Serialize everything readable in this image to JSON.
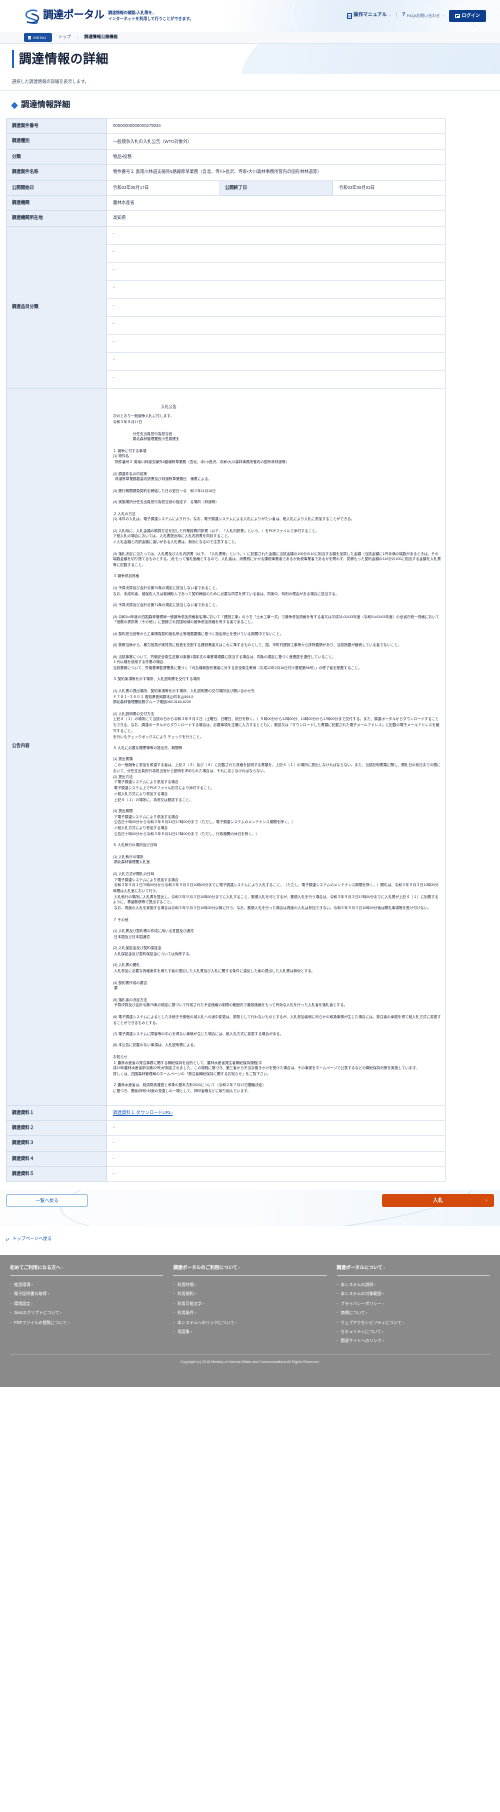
{
  "header": {
    "logo_text": "調達ポータル",
    "tagline_line1": "調達情報の確認・入札等を、",
    "tagline_line2": "インターネットを利用して行うことができます。",
    "manual_label": "操作マニュアル",
    "faq_label": "FAQ・お問い合わせ",
    "login_label": "ログイン",
    "chevron": "›",
    "separator": "|",
    "faq_icon_glyph": "?"
  },
  "breadcrumb": {
    "menu_label": "MENU",
    "items": [
      "トップ",
      "調達情報公開機能"
    ],
    "separator": "›"
  },
  "page": {
    "title": "調達情報の詳細",
    "lead": "選択した調達情報の詳細を表示します。",
    "section_title": "調達情報詳細"
  },
  "detail": {
    "rows": [
      {
        "label": "調達案件番号",
        "value": "00000000000000279034"
      },
      {
        "label": "調達種別",
        "value": "一般競争入札の入札公告（WTO対象外）"
      },
      {
        "label": "分類",
        "value": "物品・役務"
      },
      {
        "label": "調達案件名称",
        "value": "物件番号２ 奥南川林道支線外5路線除草業務（吾北、寺川・長沢、寺家・大川森林事務所管内の国有林林道等）"
      }
    ],
    "period": {
      "label_start": "公開開始日",
      "value_start": "令和03年08月17日",
      "label_end": "公開終了日",
      "value_end": "令和03年09月03日"
    },
    "agency": {
      "label": "調達機関",
      "value": "農林水産省"
    },
    "location": {
      "label": "調達機関所在地",
      "value": "高知県"
    },
    "item_category": {
      "label": "調達品目分類",
      "values": [
        "-",
        "-",
        "-",
        "-",
        "-",
        "-",
        "-",
        "-",
        "-"
      ]
    },
    "notice": {
      "label": "公告内容",
      "title": "入札公告",
      "body": "次のとおり一般競争入札に付します。\n令和３年８月17日\n\n                    分任支出負担行為担当官\n                    嶺北森林管理署長小笠原建夫\n\n１ 競争に付する事項\n(1) 物件名\n  物件番号２ 奥南川林道支線外5路線除草業務（吾北、寺川・長沢、寺家・大川森林事務所管内の国有林林道等）\n\n(2) 調達件名の内容等\n  林道除草業務数量内訳書及び林道除草業務仕　様書による。\n\n(3) 履行期間請負契約を締結した日の翌日～令　和３年11月16日\n\n(4) 実施場所分任支出負担行為担当官の指定す　る場所（林道等）\n\n２ 入札の方法\n(1) 本件の入札は、電子調達システムにより行う。なお、電子調達システムによる入札によりがたい者は、紙入札により入札に参加することができる。\n\n(2) 入札時に、入札金額の積算方法を記した作業経費内訳書（以下、「入札内訳書」という。）をPDFファイルで添付すること。\nア紙入札の場合においては、入札書提出時に入札内訳書を同封すること。\nイ入札金額と内訳金額に違いがある入札書は、無効となるので注意すること。\n\n(3) 落札決定に当たっては、入札書及び入札内訳書（以下、「入札書等」という。）に記載された金額に当該金額の100分の10に相当する額を加算した金額（当該金額に1円未満の端数があるときは、その端数金額を切り捨てるものとする。)をもって落札価格とするので、入札者は、消費税にかかる課税事業者であるか免税事業者であるかを問わず、見積もった契約金額の110分の100に相当する金額を入札書等に記載すること。\n\n３ 競争参加資格\n\n(1) 予算決算及び会計令第70条の規定に該当しない者であること。\nなお、未成年者、被保佐人又は被補助人であって契約締結のために必要な同意を得ている者は、同条中、特別の理由がある場合に該当する。\n\n(2) 予算決算及び会計令第71条の規定に該当しない者であること。\n\n(3) 令和3・4年度の四国森林管理局一般競争参加資格者名簿において「建設工事」のうち「土木工事一式」で競争参加資格を有する者又は平成31・32・33年度（令和01・02・03年度）の全省庁統一資格において「役務の提供等（その他）」に登録され四国地域の競争参加資格を有する者であること。\n\n(4) 契約担当官等から工事請負契約指名停止等措置要領に基づく指名停止を受けている期間中でないこと。\n\n(5) 警察当局から、暴力団員が実質的に経営を支配する建設業者又はこれに準ずるものとして、国、市町村建設工事等から排除要請があり、当該措置が継続している者でないこと。\n\n(6) 当該事業について、労働安全衛生法第13条第1項本文の事業場規模に該当する場合は、同条の規定に基づく産業医を選任していること。\n１代以機を使用する作業の場合\n当該業務について、労働基準監督署長に基づく「刈払機取扱作業者に対する安全衛生教育（平成12年2月16日付け基発第96号）」の修了者を配置すること。\n\n４ 契約条項等を示す場所、入札説明書を交付する場所\n\n(1) 入札書の提出場所、契約条項等を示す場所、入札説明書の交付場所及び開い合わせ先\n〒７８１−３６０１ 高知県長岡郡本山町本山504-9\n嶺北森林管理署総務グループ電話050-3160-6230\n\n(2) 入札説明書の交付方法\n上記４（１）の場所にて当該の日から令和３年９月２日（土曜日、日曜日、祝日を除く。）９時00分から12時00分、13時00分から17時00分まで交付する。また、調達ポータルからダウンロードすることもできる。なお、調達ポータルからダウンロードする場合は、必要事項を正確に入力するとともに、郵送又は「ダウンロードした書類に記載された電子メールアドレス」に記載の電子メールアドレスを厳守すること。\nを行いもチェックボックスにより チェックを行うこと。\n\n５ 入札に必要な開票簿等の提出先、期間等\n\n(1) 提出書類\n この一般競争に参加を希望する者は、上記３（３）及び（４）に記載された資格を証明する書類を、上記４（１）の場所に提出しなければならない。また、当該記明書類に関し、開札日の前日までの間において、分任支出負担行為担当官から説明を求められた場合は、それに応じなければならない。\n(2) 提出方法\n ア電子調達システムにより参加する場合\n 電子調達システム上でPDFファイル形式により添付すること。\n イ紙入札方式により参加する場合\n 上記４（１）の場所に、持参又は郵送すること。\n\n(3) 提出期間\n ア電子調達システムにより参加する場合\n 公告日十時00分から令和３年８月31日17時00分まで（ただし、電子調達システムのメンテナンス期間を除く。）\n イ紙入札方式により参加する場合\n 公告日十時00分から令和３年８月31日17時00分まで（ただし、行政機関の休日を除く。）\n\n６ 入札執行の場所及び日時\n\n(1) 入札執行の場所\n 嶺北森林管理署入札室\n\n(2) 入札方式が開札の日時\n ア電子調達システムにより参加する場合\n 令和３年９月１日９時00分から令和３年９月３日10時00分までに電子調達システムにより入札すること。（ただし、電子調達システムのメンテナンス期間を除く。）開札は、令和３年９月３日10時30分時間は入札室において行う。\n 入札執行の場所に入札書を提出し、令和３年９月３日10時00分までに入札すること。郵便入札を可とするが、郵便入札を行う場合は、令和３年９月２日17時00分までに入札書が上記４（１）に到着するように、書留郵便等で提出すること。\n なお、再度の入札を実施する場合は令和３年９月３日10時30分以降に行う。なお、郵便入札を行った場合は再度の入札は参加できない。令和３年９月３日10時00分後は開札事項等を受け付けない。\n\n７ その他\n\n(1) 入札書及び契約書の作成に用いる言語及び通貨\n 日本語及び日本国通貨\n\n(2) 入札保証金及び契約保証金\n 入札保証金及び契約保証金については免除する。\n\n(3) 入札書の開札\n 入札参加に必要な資格条件を満たす者の提出した入札書及び入札に関する条件に違反した者の提出した入札書は無効とする。\n\n(4) 契約書作成の要否\n 要\n\n(5) 落札者の決定方法\n 予算決算及び会計令第79条の規定に基づいて作成された予定価格の制限の範囲内で最低価格をもって有効な入札を行った入札者を落札者とする。\n\n(6) 電子調達システムによるとした手続き予期他の減入札への途中変更は、原則として行わないものとするが、入札参加者側に何らかの取扱事情が生じた場合には、発注者の承認を得て紙入札方式に変更することができるものとする。\n\n(7) 電子調達システムに障害等の中心を得ない事態が生じた場合には、紙入札方式に変更する場合がある。\n\n(8) 本公告に記載のない事項は、入札説明書による。\n\nお知らせ\n１ 農林水産省の発注事務に関する綱紀保持を目的として、農林水産省発注者綱紀保持規程(平\n成19年農林水産省訓令第22号)が制定されました。この規程に基づき、第三者から不当な働きかけを受けた場合は、その事実をホームページで公表するなどの綱紀保持対策を実施しています。\n詳しくは、四国森林管理局のホームページの「発注者綱紀保持に関するお知らせ」をご覧下さい。\n\n２ 農林水産省は、経済財政運営と改革の基本方針2020について（令和２年７月17日閣議決定）\nに基づき、書面・押印・対面の見直しの一環として、押印省略などに取り組んでいます。"
    },
    "materials": [
      {
        "label": "調達資料１",
        "value": "調達資料１ ダウンロードURL",
        "is_link": true,
        "chevron": "›"
      },
      {
        "label": "調達資料２",
        "value": "-",
        "is_link": false
      },
      {
        "label": "調達資料３",
        "value": "-",
        "is_link": false
      },
      {
        "label": "調達資料４",
        "value": "-",
        "is_link": false
      },
      {
        "label": "調達資料５",
        "value": "-",
        "is_link": false
      }
    ]
  },
  "actions": {
    "back_label": "一覧へ戻る",
    "bid_label": "入札",
    "bid_chevron": "›",
    "top_link_label": "トップページへ戻る"
  },
  "footer": {
    "columns": [
      {
        "heading": "初めてご利用になる方へ",
        "chevron": "›",
        "links": [
          "推奨環境",
          "電子証明書の取得",
          "環境設定",
          "Javaスクリプトについて",
          "PDFファイルの閲覧について"
        ]
      },
      {
        "heading": "調達ポータルのご利用について",
        "chevron": "›",
        "links": [
          "利用時間",
          "利用規約",
          "利用可能文字",
          "利用条件",
          "本システムへのリンクについて",
          "用語集"
        ]
      },
      {
        "heading": "調達ポータルについて",
        "chevron": "›",
        "links": [
          "本システムの説明",
          "本システムの対象範囲",
          "プライバシーポリシー",
          "商標について",
          "ウェブアクセシビリティについて",
          "セキュリティについて",
          "関連サイトへのリンク"
        ]
      }
    ],
    "copyright": "Copyright (c) 2018 Ministry of Internal Affairs and Communications All Rights Reserved."
  },
  "colors": {
    "brand_blue": "#0e3f8f",
    "accent_blue": "#1558bf",
    "bid_orange": "#d4490c",
    "header_row": "#e8eff8",
    "footer_gray": "#8a8a8a"
  }
}
